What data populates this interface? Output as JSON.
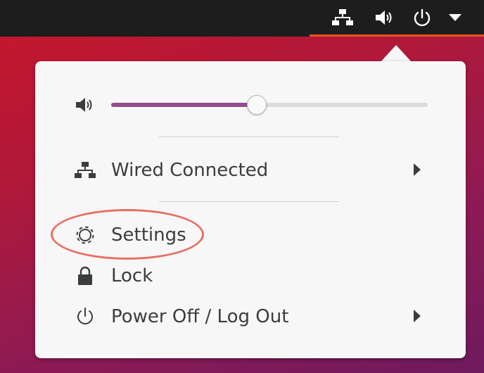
{
  "topbar": {
    "indicators": [
      {
        "icon": "network-wired-icon"
      },
      {
        "icon": "volume-icon"
      },
      {
        "icon": "power-icon"
      },
      {
        "icon": "dropdown-arrow-icon"
      }
    ]
  },
  "menu": {
    "volume": {
      "icon": "volume-icon",
      "level": 0.46
    },
    "items": [
      {
        "label": "Wired Connected",
        "icon": "network-wired-icon",
        "submenu": true
      },
      {
        "label": "Settings",
        "icon": "settings-gear-icon",
        "submenu": false
      },
      {
        "label": "Lock",
        "icon": "lock-icon",
        "submenu": false
      },
      {
        "label": "Power Off / Log Out",
        "icon": "power-icon",
        "submenu": true
      }
    ]
  },
  "colors": {
    "accent": "#e95420",
    "slider_fill": "#924d8b",
    "highlight": "#e86f63"
  }
}
